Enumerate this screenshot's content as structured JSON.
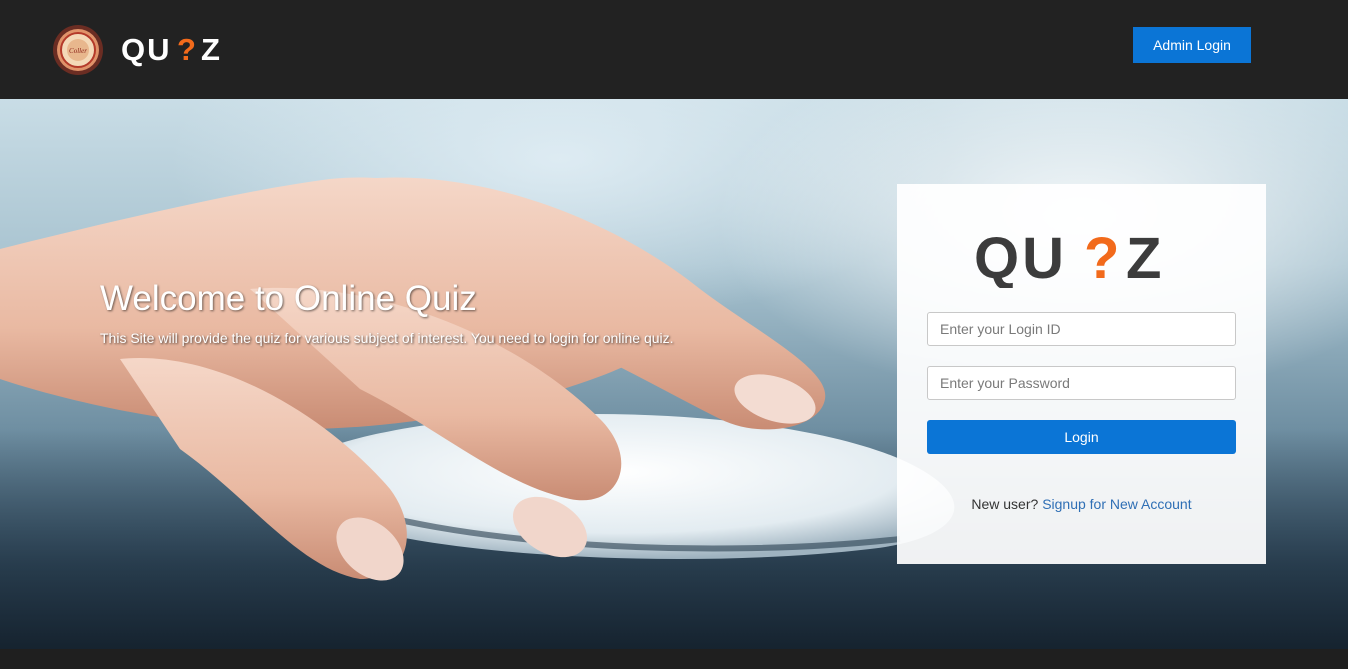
{
  "header": {
    "brand_text": "QU?Z",
    "emblem_text": "Coller",
    "admin_login_label": "Admin Login"
  },
  "hero": {
    "title": "Welcome to Online Quiz",
    "subtitle": "This Site will provide the quiz for various subject of interest. You need to login for online quiz."
  },
  "login_card": {
    "brand_text": "QU?Z",
    "login_id_placeholder": "Enter your Login ID",
    "password_placeholder": "Enter your Password",
    "login_button_label": "Login",
    "new_user_text": "New user?",
    "signup_link_text": "Signup for New Account"
  },
  "colors": {
    "header_bg": "#222222",
    "primary_button": "#0b75d6",
    "brand_accent": "#f26a1b",
    "link": "#2f6fb5"
  }
}
